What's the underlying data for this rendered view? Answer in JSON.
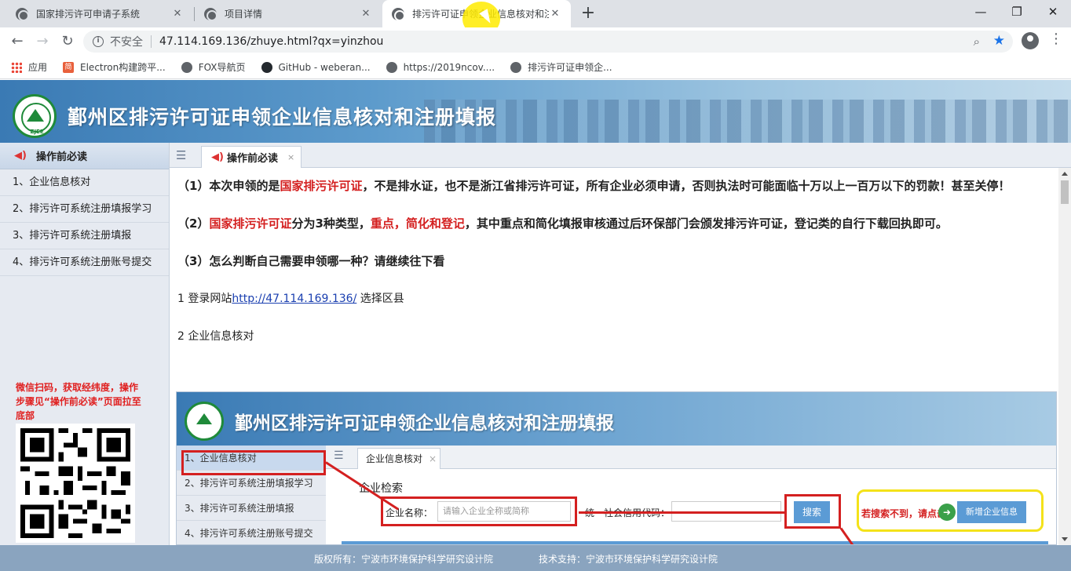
{
  "browser": {
    "tabs": [
      {
        "title": "国家排污许可申请子系统",
        "active": false
      },
      {
        "title": "项目详情",
        "active": false
      },
      {
        "title": "排污许可证申领企业信息核对和注",
        "active": true
      }
    ],
    "new_tab": "+",
    "window_controls": {
      "minimize": "—",
      "restore": "❐",
      "close": "✕"
    },
    "nav": {
      "back": "←",
      "forward": "→",
      "reload": "↻"
    },
    "address": {
      "security_label": "不安全",
      "url": "47.114.169.136/zhuye.html?qx=yinzhou"
    },
    "bookmarks": [
      {
        "label": "应用",
        "icon": "apps-grid-icon"
      },
      {
        "label": "Electron构建跨平...",
        "icon": "jian-icon"
      },
      {
        "label": "FOX导航页",
        "icon": "globe-icon"
      },
      {
        "label": "GitHub - weberan...",
        "icon": "github-icon"
      },
      {
        "label": "https://2019ncov....",
        "icon": "globe-icon"
      },
      {
        "label": "排污许可证申领企...",
        "icon": "globe-icon"
      }
    ]
  },
  "site": {
    "logo_text": "ZJEE",
    "title": "鄞州区排污许可证申领企业信息核对和注册填报"
  },
  "sidebar": {
    "header": "操作前必读",
    "items": [
      {
        "label": "1、企业信息核对"
      },
      {
        "label": "2、排污许可系统注册填报学习"
      },
      {
        "label": "3、排污许可系统注册填报"
      },
      {
        "label": "4、排污许可系统注册账号提交"
      }
    ],
    "wechat_note": "微信扫码，获取经纬度，操作步骤见“操作前必读”页面拉至底部"
  },
  "page_tab": {
    "label": "操作前必读",
    "close": "×"
  },
  "content": {
    "p1": {
      "a": "（1）本次申领的是",
      "b": "国家排污许可证",
      "c": "，不是排水证，也不是浙江省排污许可证，所有企业必须申请，否则执法时可能面临十万以上一百万以下的罚款！甚至关停！"
    },
    "p2": {
      "a": "（2）",
      "b": "国家排污许可证",
      "c": "分为3种类型，",
      "d": "重点，简化和登记",
      "e": "，其中重点和简化填报审核通过后环保部门会颁发排污许可证，登记类的自行下载回执即可。"
    },
    "p3": "（3）怎么判断自己需要申领哪一种？请继续往下看",
    "step1": {
      "prefix": "1 登录网站",
      "link": "http://47.114.169.136/",
      "suffix": "  选择区县"
    },
    "step2": "2 企业信息核对"
  },
  "embedded": {
    "title": "鄞州区排污许可证申领企业信息核对和注册填报",
    "side_items": [
      "1、企业信息核对",
      "2、排污许可系统注册填报学习",
      "3、排污许可系统注册填报",
      "4、排污许可系统注册账号提交"
    ],
    "tab": "企业信息核对",
    "section": "企业检索",
    "name_label": "企业名称：",
    "name_placeholder": "请输入企业全称或简称",
    "credit_label": "统一社会信用代码：",
    "search_button": "搜索",
    "hint": "若搜索不到，请点击",
    "add_button": "新增企业信息"
  },
  "footer": {
    "copyright": "版权所有：宁波市环境保护科学研究设计院",
    "support": "技术支持：宁波市环境保护科学研究设计院"
  }
}
